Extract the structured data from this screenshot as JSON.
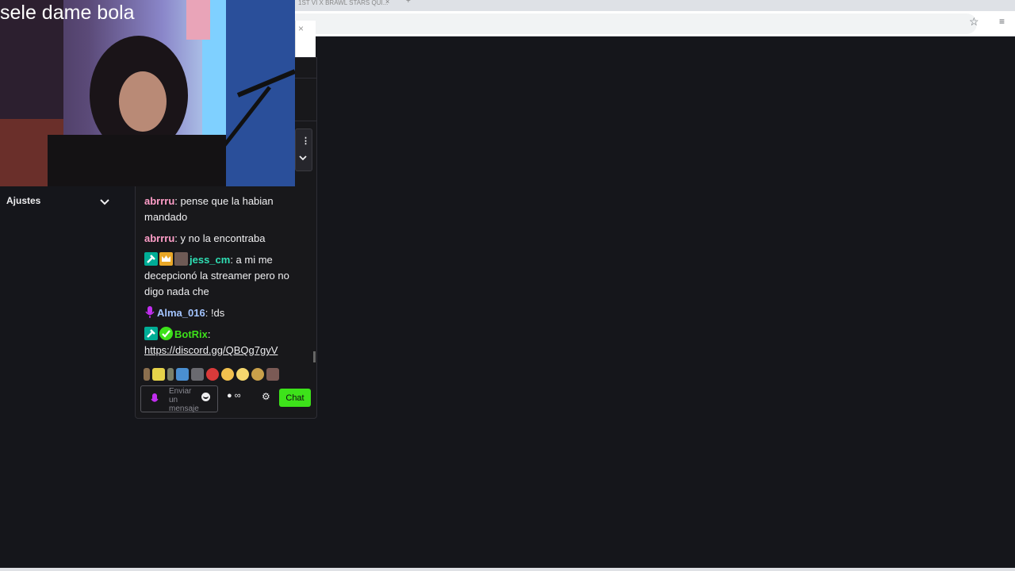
{
  "browser": {
    "tab_title": "1ST VI X BRAWL STARS QUI...",
    "tab_close": "×",
    "new_tab": "+"
  },
  "popup": {
    "close": "×"
  },
  "overlay": {
    "title": "sele dame bola"
  },
  "sidebar": {
    "settings_label": "Ajustes"
  },
  "chat": {
    "messages": [
      {
        "user": "abrrru",
        "user_color": "#ff9ec8",
        "text": ": pense que la habian mandado"
      },
      {
        "user": "abrrru",
        "user_color": "#ff9ec8",
        "text": ": y no la encontraba"
      },
      {
        "user": "jess_cm",
        "user_color": "#2fe0b5",
        "text": ": a mi me decepcionó la streamer pero no digo nada che"
      },
      {
        "user": "Alma_016",
        "user_color": "#a3c4ff",
        "text": ": !ds"
      },
      {
        "user": "BotRix",
        "user_color": "#3de21a",
        "text": ":",
        "link": "https://discord.gg/QBQg7gyV"
      }
    ],
    "input_placeholder": "Enviar un mensaje",
    "points_label": "∞",
    "send_label": "Chat",
    "colors": {
      "accent": "#3de21a",
      "mod_badge": "#00ad96",
      "vip_badge": "#e9a727",
      "mic": "#c22ef0"
    }
  }
}
